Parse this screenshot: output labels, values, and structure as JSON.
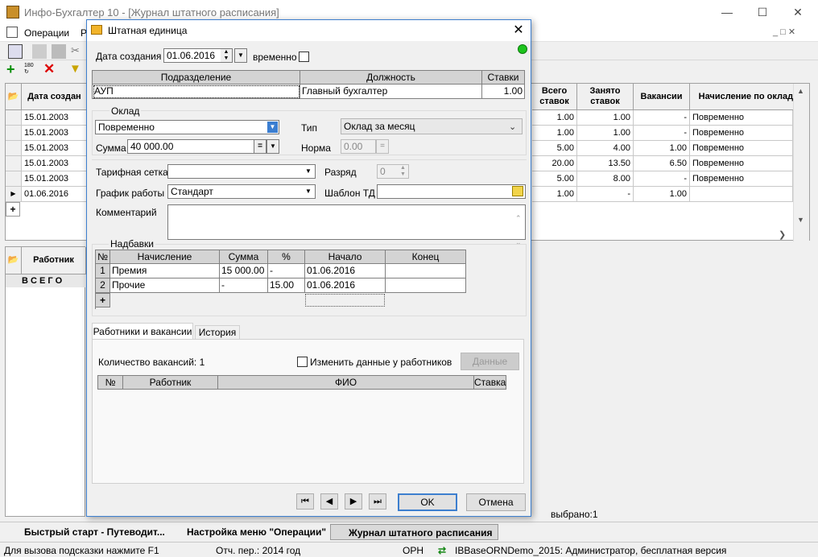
{
  "main": {
    "title": "Инфо-Бухгалтер 10 - [Журнал штатного расписания]",
    "menu": [
      "Операции",
      "Р"
    ],
    "grid": {
      "headers": [
        "Дата создан",
        "Всего ставок",
        "Занято ставок",
        "Вакансии",
        "Начисление по окладу"
      ],
      "rows": [
        {
          "date": "15.01.2003",
          "total": "1.00",
          "occupied": "1.00",
          "vacancies": "-",
          "accrual": "Повременно"
        },
        {
          "date": "15.01.2003",
          "total": "1.00",
          "occupied": "1.00",
          "vacancies": "-",
          "accrual": "Повременно"
        },
        {
          "date": "15.01.2003",
          "total": "5.00",
          "occupied": "4.00",
          "vacancies": "1.00",
          "accrual": "Повременно"
        },
        {
          "date": "15.01.2003",
          "total": "20.00",
          "occupied": "13.50",
          "vacancies": "6.50",
          "accrual": "Повременно"
        },
        {
          "date": "15.01.2003",
          "total": "5.00",
          "occupied": "8.00",
          "vacancies": "-",
          "accrual": "Повременно"
        },
        {
          "date": "01.06.2016",
          "total": "1.00",
          "occupied": "-",
          "vacancies": "1.00",
          "accrual": ""
        }
      ],
      "add_marker": "+"
    },
    "grid2": {
      "header": "Работник",
      "total_row": "В С Е Г О"
    },
    "selected": "выбрано:1"
  },
  "tabs": [
    "Быстрый старт - Путеводит...",
    "Настройка меню \"Операции\"",
    "Журнал штатного расписания"
  ],
  "status": {
    "hint": "Для вызова подсказки нажмите F1",
    "period": "Отч. пер.: 2014 год",
    "org": "ОРН",
    "db": "IBBaseORNDemo_2015: Администратор, бесплатная версия"
  },
  "dialog": {
    "title": "Штатная единица",
    "created_label": "Дата создания",
    "created_value": "01.06.2016",
    "temporary_label": "временно",
    "unit_table": {
      "headers": [
        "Подразделение",
        "Должность",
        "Ставки"
      ],
      "row": {
        "dept": "АУП",
        "position": "Главный бухгалтер",
        "rate": "1.00"
      }
    },
    "salary_group": "Оклад",
    "salary_mode": "Повременно",
    "type_label": "Тип",
    "type_value": "Оклад за месяц",
    "sum_label": "Сумма",
    "sum_value": "40 000.00",
    "norm_label": "Норма",
    "norm_value": "0.00",
    "tariff_label": "Тарифная сетка",
    "tariff_value": "",
    "grade_label": "Разряд",
    "grade_value": "0",
    "schedule_label": "График работы",
    "schedule_value": "Стандарт",
    "template_label": "Шаблон ТД",
    "template_value": "",
    "comment_label": "Комментарий",
    "comment_value": "",
    "bonus_group": "Надбавки",
    "bonus_table": {
      "headers": [
        "№",
        "Начисление",
        "Сумма",
        "%",
        "Начало",
        "Конец"
      ],
      "rows": [
        {
          "n": "1",
          "name": "Премия",
          "sum": "15 000.00",
          "pct": "-",
          "start": "01.06.2016",
          "end": ""
        },
        {
          "n": "2",
          "name": "Прочие",
          "sum": "-",
          "pct": "15.00",
          "start": "01.06.2016",
          "end": ""
        }
      ],
      "add_marker": "+"
    },
    "tab_workers": "Работники и вакансии",
    "tab_history": "История",
    "vacancies_label": "Количество вакансий: 1",
    "change_label": "Изменить данные у работников",
    "data_button": "Данные",
    "workers_headers": [
      "№",
      "Работник",
      "ФИО",
      "Ставка"
    ],
    "ok": "OK",
    "cancel": "Отмена"
  },
  "colors": {
    "status_led": "#1dc41d",
    "dialog_border": "#3d7fcf"
  }
}
